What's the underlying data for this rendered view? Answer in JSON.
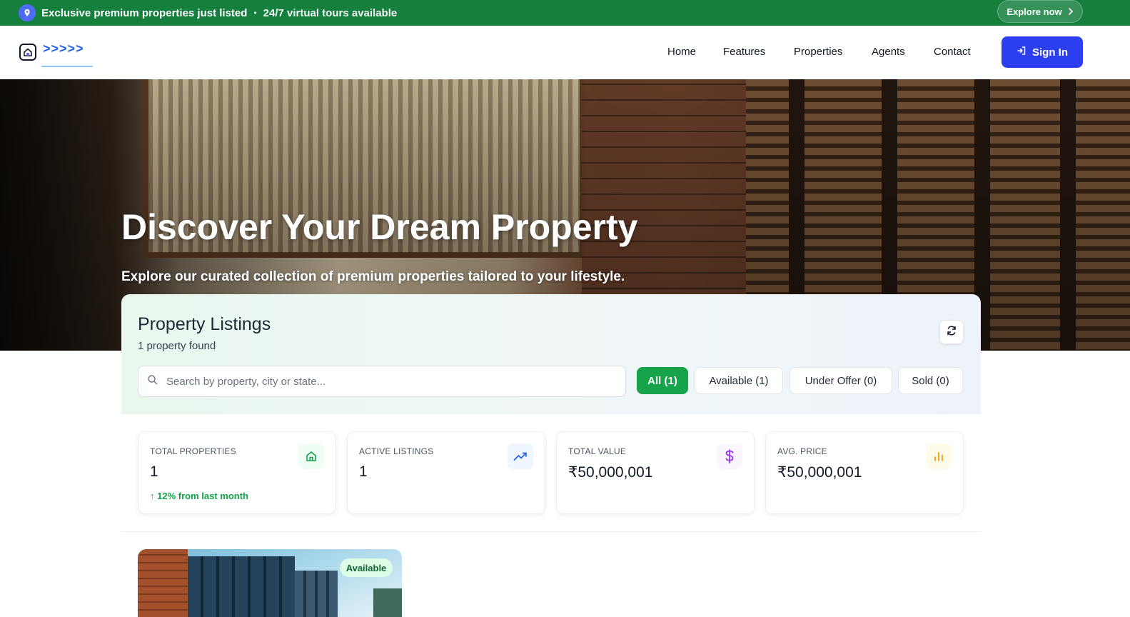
{
  "announcement": {
    "message": "Exclusive premium properties just listed",
    "separator": "•",
    "message2": "24/7 virtual tours available",
    "cta": "Explore now"
  },
  "header": {
    "logo_chevrons": ">>>>>",
    "nav": [
      "Home",
      "Features",
      "Properties",
      "Agents",
      "Contact"
    ],
    "signin_label": "Sign In"
  },
  "hero": {
    "title": "Discover Your Dream Property",
    "subtitle": "Explore our curated collection of premium properties tailored to your lifestyle."
  },
  "listings": {
    "title": "Property Listings",
    "count_text": "1 property found",
    "search_placeholder": "Search by property, city or state...",
    "filters": [
      "All (1)",
      "Available (1)",
      "Under Offer (0)",
      "Sold (0)"
    ],
    "active_filter": "All (1)"
  },
  "stats": [
    {
      "label": "TOTAL PROPERTIES",
      "value": "1",
      "trend": "↑ 12% from last month",
      "icon": "home-icon",
      "color": "#16a34a"
    },
    {
      "label": "ACTIVE LISTINGS",
      "value": "1",
      "trend": "",
      "icon": "trending-up-icon",
      "color": "#2563eb"
    },
    {
      "label": "TOTAL VALUE",
      "value": "₹50,000,001",
      "trend": "",
      "icon": "dollar-icon",
      "color": "#9333ea"
    },
    {
      "label": "AVG. PRICE",
      "value": "₹50,000,001",
      "trend": "",
      "icon": "bar-chart-icon",
      "color": "#f59e0b"
    }
  ],
  "property_card": {
    "status_badge": "Available"
  },
  "colors": {
    "announcement_bg": "#15803d",
    "primary": "#2b3ff0",
    "active_filter": "#16a34a"
  }
}
